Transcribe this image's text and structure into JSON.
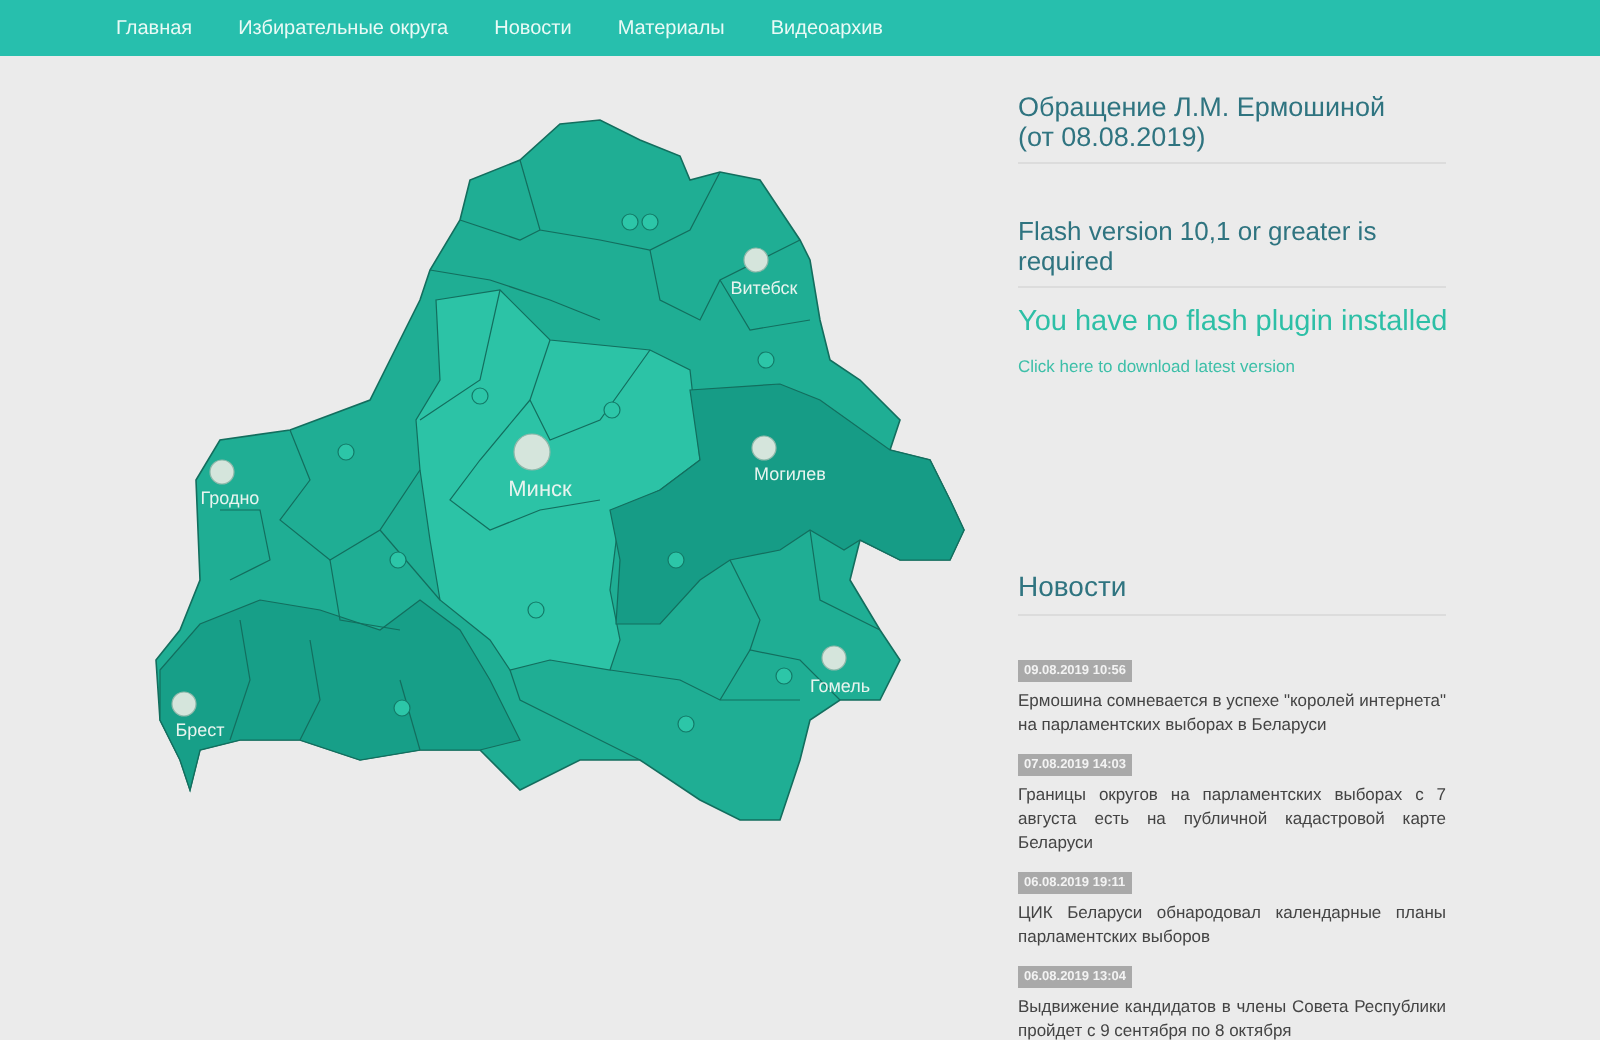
{
  "nav": [
    {
      "label": "Главная"
    },
    {
      "label": "Избирательные округа"
    },
    {
      "label": "Новости"
    },
    {
      "label": "Материалы"
    },
    {
      "label": "Видеоархив"
    }
  ],
  "map": {
    "cities": [
      {
        "name": "Витебск",
        "kind": "regional"
      },
      {
        "name": "Минск",
        "kind": "capital"
      },
      {
        "name": "Могилев",
        "kind": "regional"
      },
      {
        "name": "Гродно",
        "kind": "regional"
      },
      {
        "name": "Брест",
        "kind": "regional"
      },
      {
        "name": "Гомель",
        "kind": "regional"
      }
    ]
  },
  "sidebar": {
    "appeal_title": "Обращение Л.М. Ермошиной (от 08.08.2019)",
    "flash_notice": "Flash version 10,1 or greater is required",
    "flash_message": "You have no flash plugin installed",
    "download_link": "Click here to download latest version"
  },
  "news": {
    "title": "Новости",
    "items": [
      {
        "date": "09.08.2019 10:56",
        "text": "Ермошина сомневается в успехе \"королей интернета\" на парламентских выборах в Беларуси"
      },
      {
        "date": "07.08.2019 14:03",
        "text": "Границы округов на парламентских выборах с 7 августа есть на публичной кадастровой карте Беларуси"
      },
      {
        "date": "06.08.2019 19:11",
        "text": "ЦИК Беларуси обнародовал календарные планы парламентских выборов"
      },
      {
        "date": "06.08.2019 13:04",
        "text": "Выдвижение кандидатов в члены Совета Республики пройдет с 9 сентября по 8 октября"
      }
    ]
  }
}
